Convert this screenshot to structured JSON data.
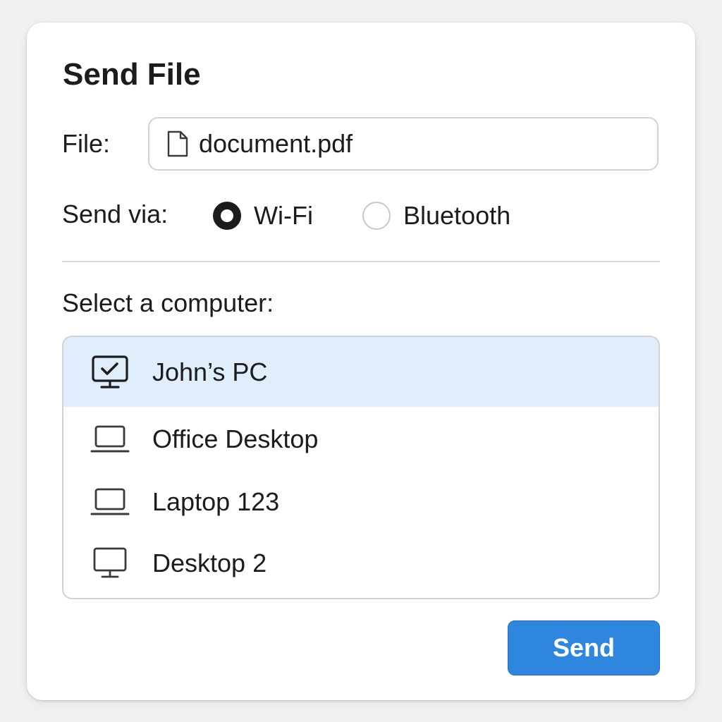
{
  "dialog": {
    "title": "Send File"
  },
  "file": {
    "label": "File:",
    "value": "document.pdf",
    "icon": "document-icon"
  },
  "send_via": {
    "label": "Send via:",
    "options": [
      {
        "label": "Wi-Fi",
        "selected": true
      },
      {
        "label": "Bluetooth",
        "selected": false
      }
    ]
  },
  "computers": {
    "label": "Select a computer:",
    "items": [
      {
        "label": "John’s PC",
        "icon": "monitor-check-icon",
        "selected": true
      },
      {
        "label": "Office Desktop",
        "icon": "laptop-icon",
        "selected": false
      },
      {
        "label": "Laptop 123",
        "icon": "laptop-icon",
        "selected": false
      },
      {
        "label": "Desktop 2",
        "icon": "monitor-icon",
        "selected": false
      }
    ]
  },
  "actions": {
    "send_label": "Send"
  },
  "colors": {
    "accent": "#2f86de",
    "selection": "#e0eefc",
    "border": "#d1d1d6",
    "text": "#1c1c1e"
  }
}
